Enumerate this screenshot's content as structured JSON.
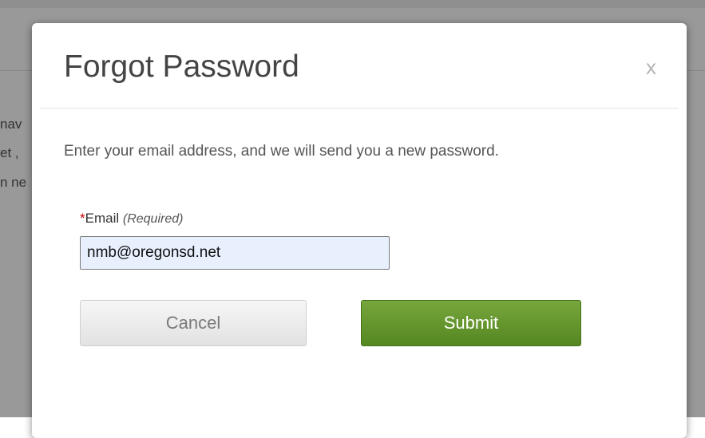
{
  "background": {
    "text_fragments": [
      "nav",
      "et ,",
      "n ne"
    ]
  },
  "modal": {
    "title": "Forgot Password",
    "close_label": "x",
    "instructions": "Enter your email address, and we will send you a new password.",
    "email_field": {
      "required_marker": "*",
      "label": "Email",
      "required_note": "(Required)",
      "value": "nmb@oregonsd.net"
    },
    "cancel_label": "Cancel",
    "submit_label": "Submit"
  },
  "colors": {
    "submit_button": "#62952c",
    "required_marker": "#cc0000",
    "backdrop": "#999999",
    "autofill_background": "#e8f0fe"
  }
}
